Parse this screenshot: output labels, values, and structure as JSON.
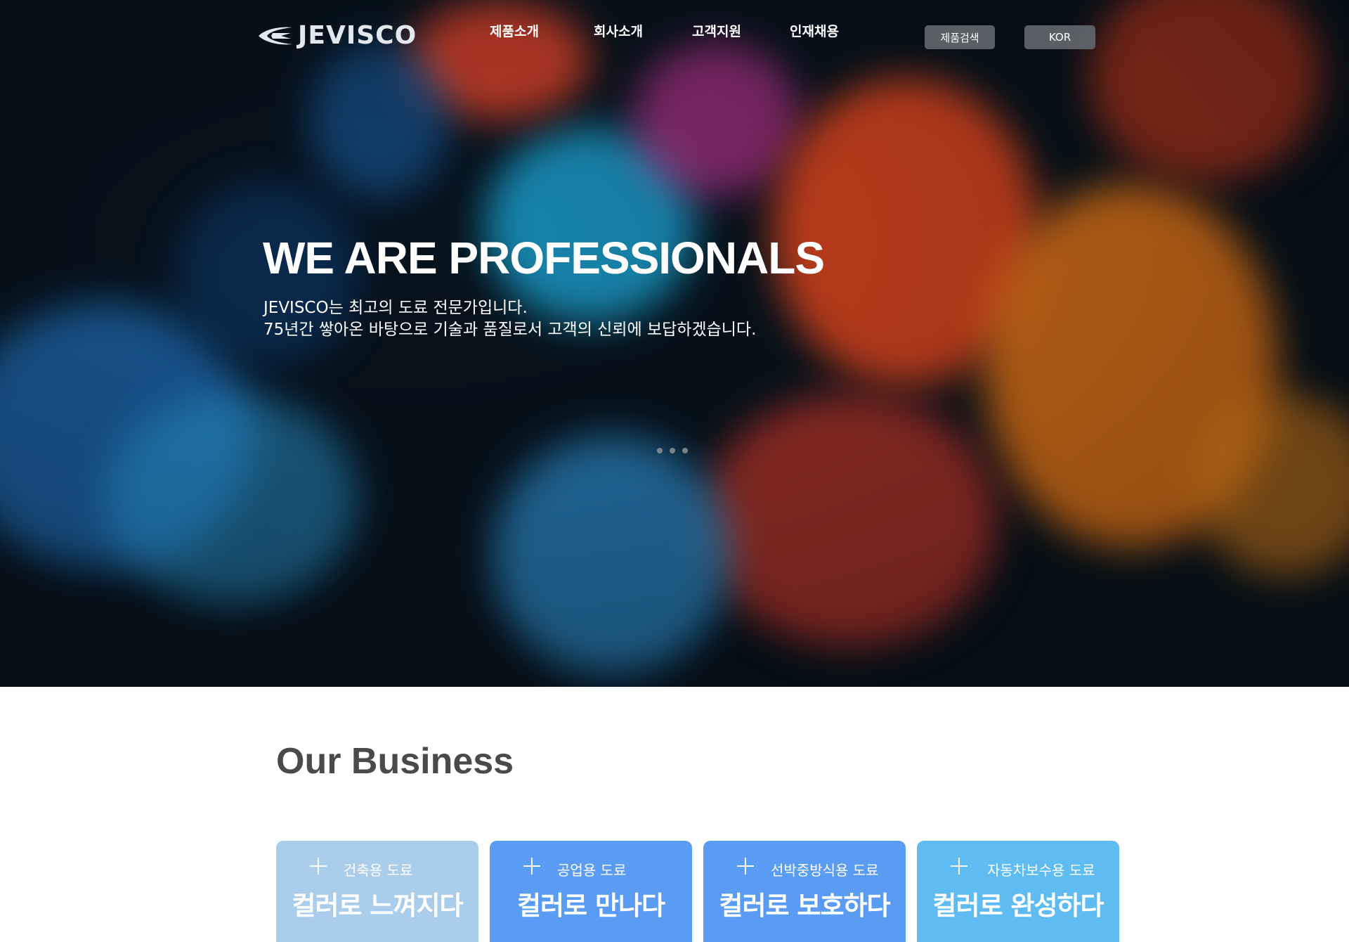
{
  "brand": {
    "logo_text": "JEVISCO"
  },
  "nav": {
    "items": [
      {
        "label": "제품소개"
      },
      {
        "label": "회사소개"
      },
      {
        "label": "고객지원"
      },
      {
        "label": "인재채용"
      }
    ],
    "product_search_label": "제품검색",
    "language_label": "KOR"
  },
  "hero": {
    "headline": "WE ARE PROFESSIONALS",
    "line1": "JEVISCO는 최고의 도료 전문가입니다.",
    "line2": "75년간 쌓아온   바탕으로   기술과 품질로서 고객의 신뢰에 보답하겠습니다.",
    "slider_dots": 3
  },
  "business": {
    "title": "Our Business",
    "cards": [
      {
        "tag": "건축용 도료",
        "title": "컬러로 느껴지다",
        "color": "#a9cdeb"
      },
      {
        "tag": "공업용 도료",
        "title": "컬러로 만나다",
        "color": "#5a9cf3"
      },
      {
        "tag": "선박중방식용 도료",
        "title": "컬러로 보호하다",
        "color": "#5a9cf3"
      },
      {
        "tag": "자동차보수용 도료",
        "title": "컬러로 완성하다",
        "color": "#5fbcf2"
      }
    ]
  },
  "colors": {
    "hero_bg": "#06121c",
    "pill_bg": "#62666c",
    "title_text": "#4a4a4a"
  },
  "icons": [
    "logo-swoosh-icon",
    "plus-icon"
  ]
}
